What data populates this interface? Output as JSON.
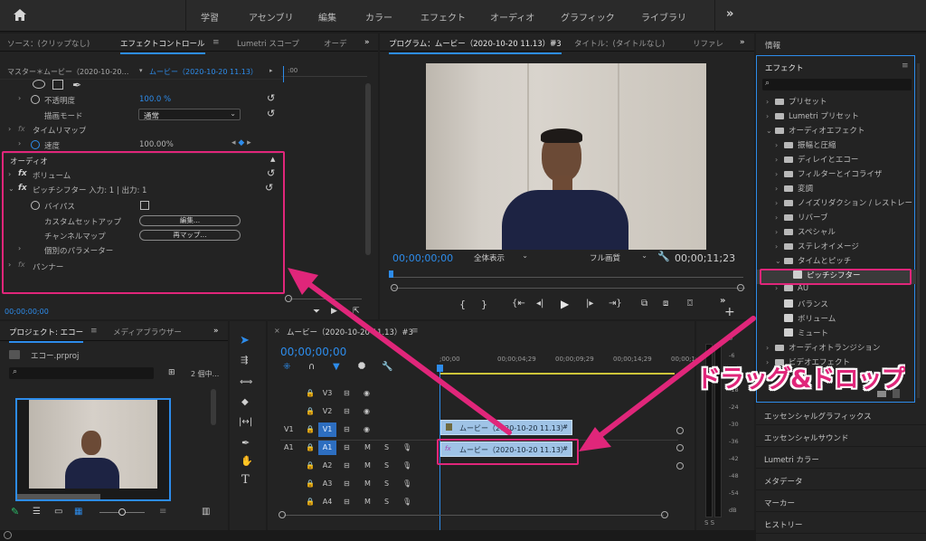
{
  "topbar": {
    "items": [
      "学習",
      "アセンブリ",
      "編集",
      "カラー",
      "エフェクト",
      "オーディオ",
      "グラフィック",
      "ライブラリ"
    ],
    "overflow": "»"
  },
  "effect_controls": {
    "tabs": [
      "ソース：(クリップなし)",
      "エフェクトコントロール",
      "Lumetri スコープ",
      "オーデ"
    ],
    "menu": "≡",
    "overflow": "»",
    "master_label": "マスター＊ムービー（2020-10-20…",
    "clip_label": "ムービー（2020-10-20 11.13）",
    "opacity_label": "不透明度",
    "opacity_value": "100.0 %",
    "blend_label": "描画モード",
    "blend_value": "通常",
    "time_remap_label": "タイムリマップ",
    "speed_label": "速度",
    "speed_value": "100.00%",
    "audio_label": "オーディオ",
    "volume_label": "ボリューム",
    "pitch_label": "ピッチシフター 入力: 1 | 出力: 1",
    "bypass_label": "バイパス",
    "custom_setup_label": "カスタムセットアップ",
    "custom_setup_button": "編集...",
    "channel_map_label": "チャンネルマップ",
    "channel_map_button": "再マップ...",
    "individual_params_label": "個別のパラメーター",
    "panner_label": "パンナー",
    "timecode": "00;00;00;00"
  },
  "program_monitor": {
    "tabs": [
      "プログラム：ムービー（2020-10-20 11.13）#3",
      "タイトル：(タイトルなし)",
      "リファレ"
    ],
    "menu": "≡",
    "overflow": "»",
    "timecode_left": "00;00;00;00",
    "fit": "全体表示",
    "quality": "フル画質",
    "timecode_right": "00;00;11;23"
  },
  "right_panel": {
    "info_label": "情報",
    "effects_title": "エフェクト",
    "menu": "≡",
    "tree": [
      {
        "label": "プリセット",
        "indent": 0,
        "kind": "bin",
        "open": false
      },
      {
        "label": "Lumetri プリセット",
        "indent": 0,
        "kind": "bin",
        "open": false
      },
      {
        "label": "オーディオエフェクト",
        "indent": 0,
        "kind": "bin",
        "open": true
      },
      {
        "label": "振幅と圧縮",
        "indent": 1,
        "kind": "folder",
        "open": false
      },
      {
        "label": "ディレイとエコー",
        "indent": 1,
        "kind": "folder",
        "open": false
      },
      {
        "label": "フィルターとイコライザ",
        "indent": 1,
        "kind": "folder",
        "open": false
      },
      {
        "label": "変調",
        "indent": 1,
        "kind": "folder",
        "open": false
      },
      {
        "label": "ノイズリダクション / レストレー",
        "indent": 1,
        "kind": "folder",
        "open": false
      },
      {
        "label": "リバーブ",
        "indent": 1,
        "kind": "folder",
        "open": false
      },
      {
        "label": "スペシャル",
        "indent": 1,
        "kind": "folder",
        "open": false
      },
      {
        "label": "ステレオイメージ",
        "indent": 1,
        "kind": "folder",
        "open": false
      },
      {
        "label": "タイムとピッチ",
        "indent": 1,
        "kind": "folder",
        "open": true
      },
      {
        "label": "ピッチシフター",
        "indent": 2,
        "kind": "fx",
        "open": false
      },
      {
        "label": "AU",
        "indent": 1,
        "kind": "folder",
        "open": false
      },
      {
        "label": "バランス",
        "indent": 1,
        "kind": "fx",
        "open": false
      },
      {
        "label": "ボリューム",
        "indent": 1,
        "kind": "fx",
        "open": false
      },
      {
        "label": "ミュート",
        "indent": 1,
        "kind": "fx",
        "open": false
      },
      {
        "label": "オーディオトランジション",
        "indent": 0,
        "kind": "bin",
        "open": false
      },
      {
        "label": "ビデオエフェクト",
        "indent": 0,
        "kind": "bin",
        "open": false
      }
    ],
    "sections": [
      "エッセンシャルグラフィックス",
      "エッセンシャルサウンド",
      "Lumetri カラー",
      "メタデータ",
      "マーカー",
      "ヒストリー"
    ]
  },
  "project": {
    "tabs": [
      "プロジェクト: エコー",
      "メディアブラウザー"
    ],
    "menu": "≡",
    "overflow": "»",
    "file": "エコー.prproj",
    "count": "2 個中..."
  },
  "timeline": {
    "title": "ムービー（2020-10-20 11.13）#3",
    "menu": "≡",
    "close": "×",
    "timecode": "00;00;00;00",
    "ruler": [
      ";00;00",
      "00;00;04;29",
      "00;00;09;29",
      "00;00;14;29",
      "00;00;1("
    ],
    "tracks": [
      {
        "src": "",
        "name": "V3"
      },
      {
        "src": "",
        "name": "V2"
      },
      {
        "src": "V1",
        "name": "V1"
      },
      {
        "src": "A1",
        "name": "A1"
      },
      {
        "src": "",
        "name": "A2"
      },
      {
        "src": "",
        "name": "A3"
      },
      {
        "src": "",
        "name": "A4"
      }
    ],
    "video_clip": "ムービー（2020-10-20 11.13）",
    "audio_clip": "ムービー（2020-10-20 11.13）",
    "m_label": "M",
    "s_label": "S"
  },
  "meter": {
    "db": [
      "0",
      "-6",
      "-12",
      "-18",
      "-24",
      "-30",
      "-36",
      "-42",
      "-48",
      "-54",
      "dB"
    ]
  },
  "annotation": {
    "text": "ドラッグ&ドロップ",
    "color": "#e0267a"
  },
  "colors": {
    "accent": "#2d8ceb",
    "highlight": "#e0267a",
    "clip": "#9fc3e6"
  }
}
